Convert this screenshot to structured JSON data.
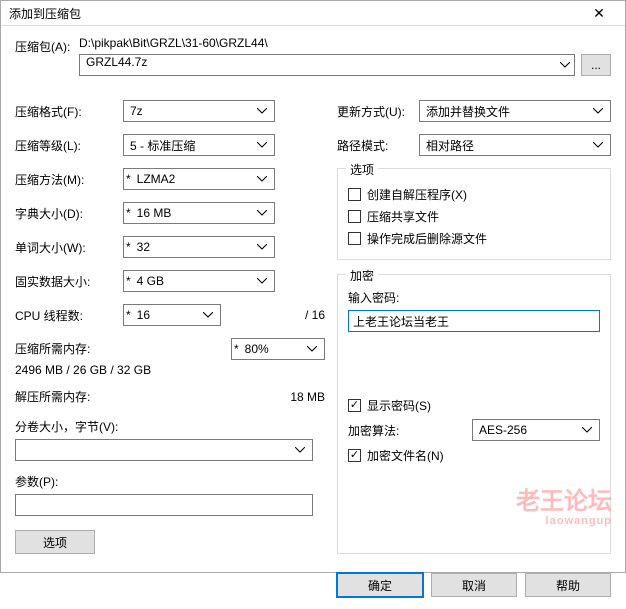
{
  "window": {
    "title": "添加到压缩包",
    "close_icon": "✕"
  },
  "archive": {
    "label": "压缩包(A):",
    "path": "D:\\pikpak\\Bit\\GRZL\\31-60\\GRZL44\\",
    "name": "GRZL44.7z",
    "browse": "..."
  },
  "left": {
    "format_label": "压缩格式(F):",
    "format_value": "7z",
    "level_label": "压缩等级(L):",
    "level_value": "5 - 标准压缩",
    "method_label": "压缩方法(M):",
    "method_value": "LZMA2",
    "dict_label": "字典大小(D):",
    "dict_value": "16 MB",
    "word_label": "单词大小(W):",
    "word_value": "32",
    "solid_label": "固实数据大小:",
    "solid_value": "4 GB",
    "cpu_label": "CPU 线程数:",
    "cpu_value": "16",
    "cpu_total": "/ 16",
    "compress_mem_label": "压缩所需内存:",
    "compress_mem_value": "2496 MB / 26 GB / 32 GB",
    "compress_mem_pct": "80%",
    "decompress_mem_label": "解压所需内存:",
    "decompress_mem_value": "18 MB",
    "volume_label": "分卷大小，字节(V):",
    "volume_value": "",
    "param_label": "参数(P):",
    "param_value": "",
    "options_btn": "选项"
  },
  "right": {
    "update_label": "更新方式(U):",
    "update_value": "添加并替换文件",
    "pathmode_label": "路径模式:",
    "pathmode_value": "相对路径",
    "options_group": "选项",
    "opt_sfx": "创建自解压程序(X)",
    "opt_shared": "压缩共享文件",
    "opt_delete": "操作完成后删除源文件",
    "enc_group": "加密",
    "pwd_label": "输入密码:",
    "pwd_value": "上老王论坛当老王",
    "show_pwd": "显示密码(S)",
    "show_pwd_checked": true,
    "algo_label": "加密算法:",
    "algo_value": "AES-256",
    "enc_names": "加密文件名(N)",
    "enc_names_checked": true
  },
  "footer": {
    "ok": "确定",
    "cancel": "取消",
    "help": "帮助"
  },
  "watermark": {
    "main": "老王论坛",
    "sub": "laowangup"
  }
}
